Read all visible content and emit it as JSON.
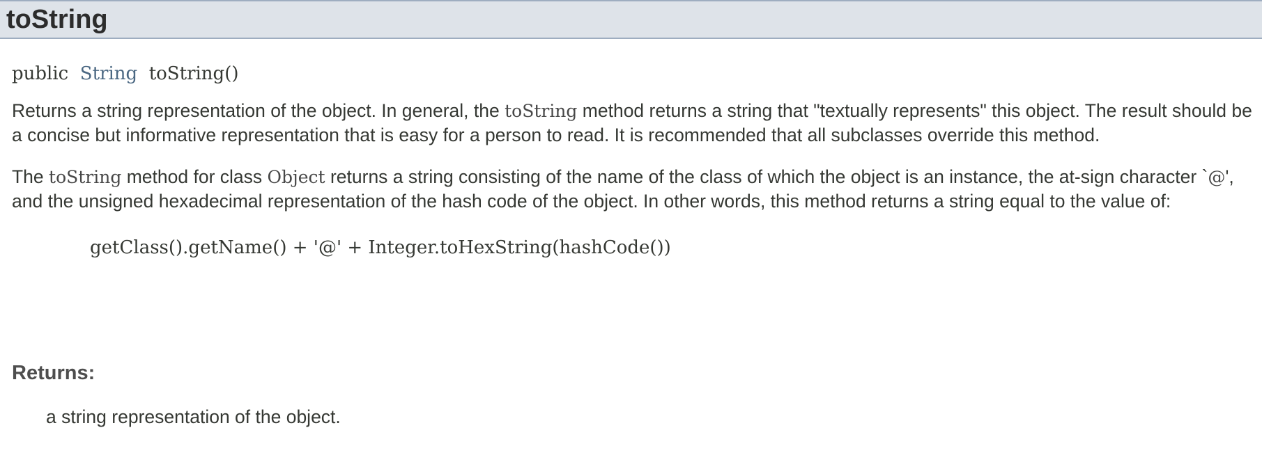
{
  "header": {
    "title": "toString"
  },
  "signature": {
    "modifier": "public",
    "return_type": "String",
    "method": "toString()"
  },
  "description": {
    "para1": {
      "before": "Returns a string representation of the object. In general, the ",
      "code": "toString",
      "after": " method returns a string that \"textually represents\" this object. The result should be a concise but informative representation that is easy for a person to read. It is recommended that all subclasses override this method."
    },
    "para2": {
      "part1": "The ",
      "code1": "toString",
      "part2": " method for class ",
      "code2": "Object",
      "part3": " returns a string consisting of the name of the class of which the object is an instance, the at-sign character `",
      "code3": "@",
      "part4": "', and the unsigned hexadecimal representation of the hash code of the object. In other words, this method returns a string equal to the value of:"
    },
    "code_example": "getClass().getName() + '@' + Integer.toHexString(hashCode())"
  },
  "returns": {
    "label": "Returns:",
    "description": "a string representation of the object."
  }
}
